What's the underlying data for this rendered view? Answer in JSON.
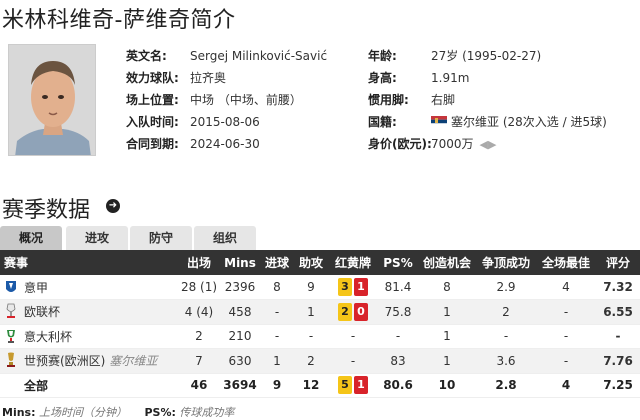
{
  "page_title": "米林科维奇-萨维奇简介",
  "profile": {
    "english_name_label": "英文名:",
    "english_name": "Sergej Milinković-Savić",
    "club_label": "效力球队:",
    "club": "拉齐奥",
    "position_label": "场上位置:",
    "position": "中场 （中场、前腰）",
    "joined_label": "入队时间:",
    "joined": "2015-08-06",
    "contract_label": "合同到期:",
    "contract": "2024-06-30",
    "age_label": "年龄:",
    "age": "27岁  (1995-02-27)",
    "height_label": "身高:",
    "height": "1.91m",
    "foot_label": "惯用脚:",
    "foot": "右脚",
    "nation_label": "国籍:",
    "nation": "塞尔维亚 (28次入选 / 进5球)",
    "value_label": "身价(欧元):",
    "value": "7000万"
  },
  "section_title": "赛季数据",
  "tabs": [
    {
      "label": "概况"
    },
    {
      "label": "进攻"
    },
    {
      "label": "防守"
    },
    {
      "label": "组织"
    }
  ],
  "table": {
    "headers": [
      "赛事",
      "出场",
      "Mins",
      "进球",
      "助攻",
      "红黄牌",
      "PS%",
      "创造机会",
      "争顶成功",
      "全场最佳",
      "评分"
    ],
    "rows": [
      {
        "comp": "意甲",
        "note": "",
        "apps": "28 (1)",
        "mins": "2396",
        "goals": "8",
        "assists": "9",
        "yellow": "3",
        "red": "1",
        "cards": "",
        "ps": "81.4",
        "chances": "8",
        "aerials": "2.9",
        "motm": "4",
        "rating": "7.32"
      },
      {
        "comp": "欧联杯",
        "note": "",
        "apps": "4 (4)",
        "mins": "458",
        "goals": "-",
        "assists": "1",
        "yellow": "2",
        "red": "0",
        "cards": "",
        "ps": "75.8",
        "chances": "1",
        "aerials": "2",
        "motm": "-",
        "rating": "6.55"
      },
      {
        "comp": "意大利杯",
        "note": "",
        "apps": "2",
        "mins": "210",
        "goals": "-",
        "assists": "-",
        "yellow": "",
        "red": "",
        "cards": "-",
        "ps": "-",
        "chances": "1",
        "aerials": "-",
        "motm": "-",
        "rating": "-"
      },
      {
        "comp": "世预赛(欧洲区)",
        "note": "塞尔维亚",
        "apps": "7",
        "mins": "630",
        "goals": "1",
        "assists": "2",
        "yellow": "",
        "red": "",
        "cards": "-",
        "ps": "83",
        "chances": "1",
        "aerials": "3.6",
        "motm": "-",
        "rating": "7.76"
      },
      {
        "comp": "全部",
        "note": "",
        "apps": "46",
        "mins": "3694",
        "goals": "9",
        "assists": "12",
        "yellow": "5",
        "red": "1",
        "cards": "",
        "ps": "80.6",
        "chances": "10",
        "aerials": "2.8",
        "motm": "4",
        "rating": "7.25"
      }
    ]
  },
  "footnote": {
    "mins_key": "Mins:",
    "mins_desc": "上场时间（分钟）",
    "ps_key": "PS%:",
    "ps_desc": "传球成功率"
  },
  "colors": {
    "header_bg": "#333333",
    "rating": "#e07020",
    "yellow_card": "#f5c518",
    "red_card": "#d8232a"
  }
}
